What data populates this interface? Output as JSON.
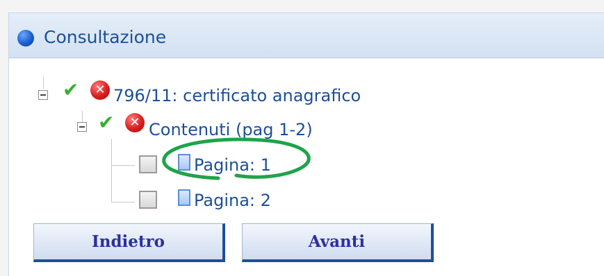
{
  "panel": {
    "title": "Consultazione"
  },
  "tree": {
    "root_label": "796/11: certificato anagrafico",
    "child_label": "Contenuti (pag 1-2)",
    "pages": [
      "Pagina: 1",
      "Pagina: 2"
    ]
  },
  "buttons": {
    "back_label": "Indietro",
    "next_label": "Avanti"
  },
  "colors": {
    "accent_blue": "#1d4f98",
    "button_text": "#2c2f9f",
    "check_green": "#35b12d",
    "annotation_green": "#1fa34a",
    "error_red": "#d81e1e"
  }
}
